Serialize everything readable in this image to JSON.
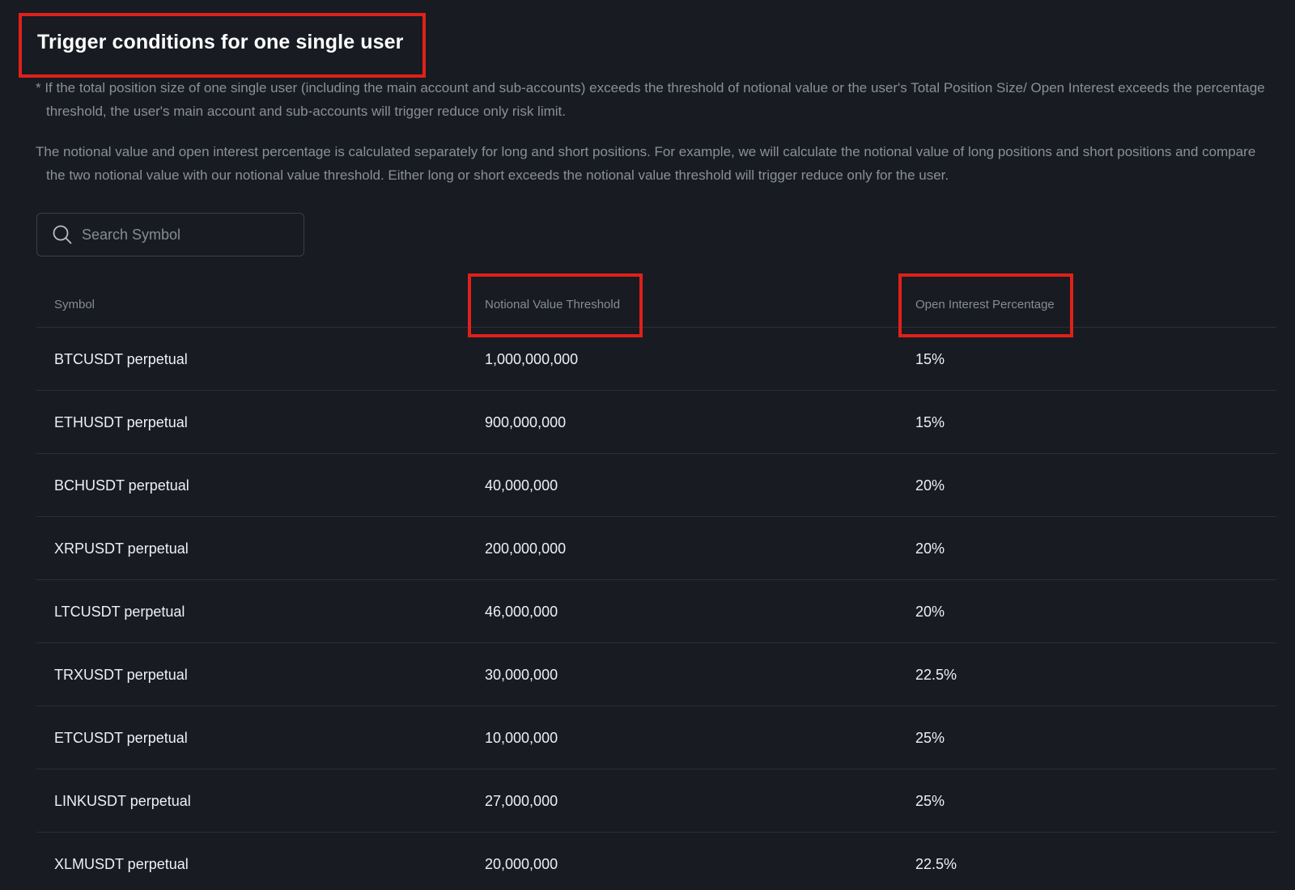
{
  "title": "Trigger conditions for one single user",
  "notes": [
    "* If the total position size of one single user (including the main account and sub-accounts) exceeds the threshold of notional value or the user's Total Position Size/ Open Interest exceeds the percentage threshold, the user's main account and sub-accounts will trigger reduce only risk limit.",
    "The notional value and open interest percentage is calculated separately for long and short positions. For example, we will calculate the notional value of long positions and short positions and compare the two notional value with our notional value threshold. Either long or short exceeds the notional value threshold will trigger reduce only for the user."
  ],
  "search": {
    "placeholder": "Search Symbol",
    "value": "",
    "icon": "search-icon"
  },
  "table": {
    "headers": [
      "Symbol",
      "Notional Value Threshold",
      "Open Interest Percentage"
    ],
    "rows": [
      [
        "BTCUSDT perpetual",
        "1,000,000,000",
        "15%"
      ],
      [
        "ETHUSDT perpetual",
        "900,000,000",
        "15%"
      ],
      [
        "BCHUSDT perpetual",
        "40,000,000",
        "20%"
      ],
      [
        "XRPUSDT perpetual",
        "200,000,000",
        "20%"
      ],
      [
        "LTCUSDT perpetual",
        "46,000,000",
        "20%"
      ],
      [
        "TRXUSDT perpetual",
        "30,000,000",
        "22.5%"
      ],
      [
        "ETCUSDT perpetual",
        "10,000,000",
        "25%"
      ],
      [
        "LINKUSDT perpetual",
        "27,000,000",
        "25%"
      ],
      [
        "XLMUSDT perpetual",
        "20,000,000",
        "22.5%"
      ]
    ]
  },
  "colors": {
    "background": "#181b22",
    "highlight": "#e0201a",
    "muted_text": "#8a8f99",
    "primary_text": "#eef0f3"
  }
}
